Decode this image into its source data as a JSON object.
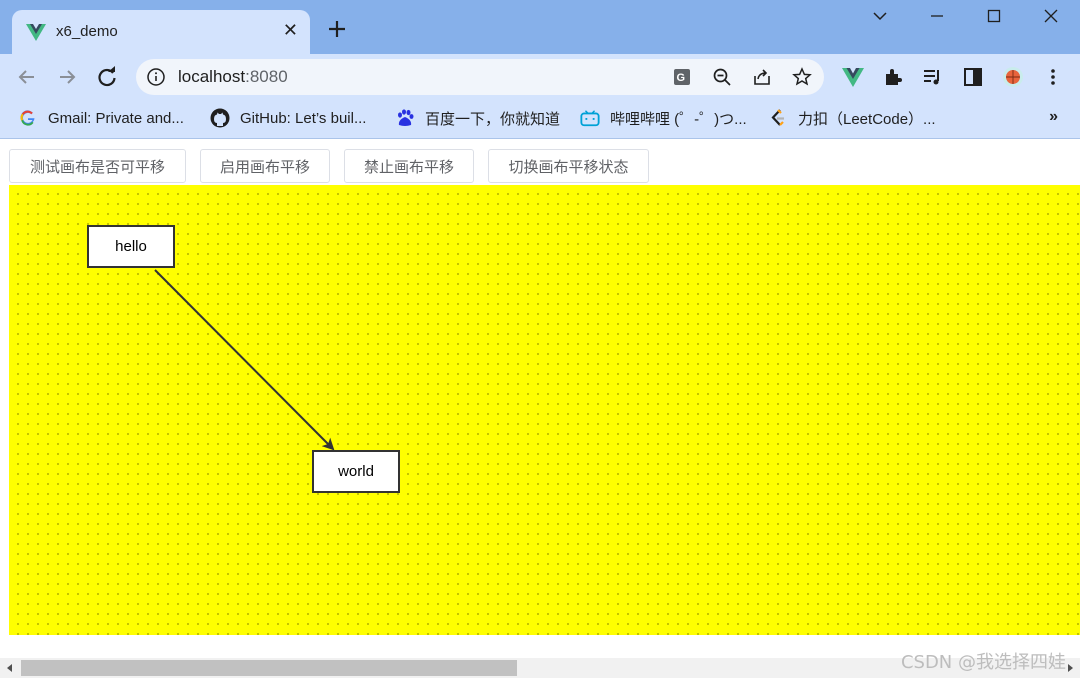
{
  "browser": {
    "tab": {
      "title": "x6_demo"
    },
    "address": {
      "host": "localhost",
      "port": ":8080"
    },
    "bookmarks": [
      {
        "label": "Gmail: Private and...",
        "icon": "google-icon"
      },
      {
        "label": "GitHub: Let’s buil...",
        "icon": "github-icon"
      },
      {
        "label": "百度一下，你就知道",
        "icon": "baidu-icon"
      },
      {
        "label": "哔哩哔哩 (゜-゜)つ...",
        "icon": "bilibili-icon"
      },
      {
        "label": "力扣（LeetCode）...",
        "icon": "leetcode-icon"
      }
    ],
    "more_bookmarks": "»"
  },
  "buttons": {
    "test": "测试画布是否可平移",
    "enable": "启用画布平移",
    "disable": "禁止画布平移",
    "toggle": "切换画布平移状态"
  },
  "graph": {
    "background": "#ffff00",
    "nodes": [
      {
        "id": "hello",
        "label": "hello"
      },
      {
        "id": "world",
        "label": "world"
      }
    ],
    "edges": [
      {
        "source": "hello",
        "target": "world"
      }
    ]
  },
  "watermark": "CSDN @我选择四娃",
  "colors": {
    "accent": "#42b883",
    "chrome": "#d3e3fd",
    "tabstrip": "#86b0ea"
  }
}
